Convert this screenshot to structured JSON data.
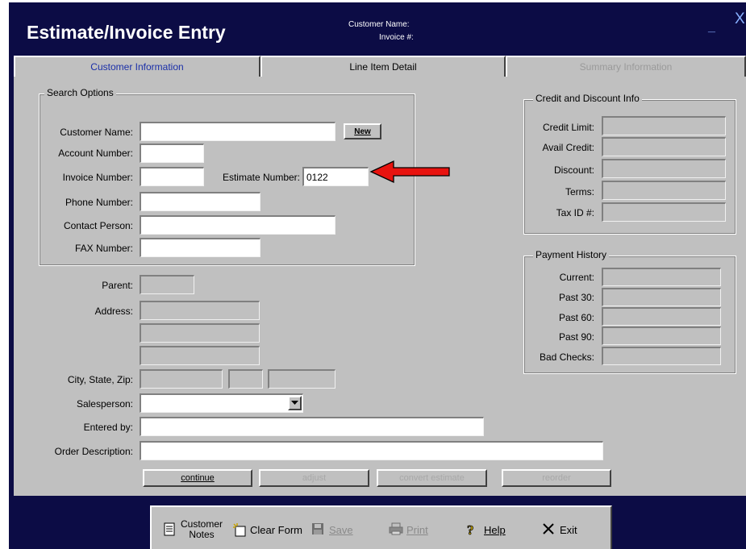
{
  "window": {
    "title": "Estimate/Invoice Entry",
    "customer_name_label": "Customer Name:",
    "invoice_label": "Invoice #:",
    "minimize": "_",
    "close": "X"
  },
  "tabs": [
    {
      "label": "Customer Information",
      "state": "active"
    },
    {
      "label": "Line Item Detail",
      "state": "normal"
    },
    {
      "label": "Summary Information",
      "state": "disabled"
    }
  ],
  "search": {
    "legend": "Search Options",
    "customer_name_label": "Customer Name:",
    "customer_name_value": "",
    "new_button": "New",
    "account_number_label": "Account Number:",
    "account_number_value": "",
    "invoice_number_label": "Invoice Number:",
    "invoice_number_value": "",
    "estimate_number_label": "Estimate Number:",
    "estimate_number_value": "0122",
    "phone_label": "Phone Number:",
    "phone_value": "",
    "contact_label": "Contact Person:",
    "contact_value": "",
    "fax_label": "FAX Number:",
    "fax_value": ""
  },
  "customer": {
    "parent_label": "Parent:",
    "address_label": "Address:",
    "city_state_zip_label": "City, State, Zip:",
    "salesperson_label": "Salesperson:",
    "salesperson_value": "",
    "entered_by_label": "Entered by:",
    "entered_by_value": "",
    "order_description_label": "Order Description:",
    "order_description_value": ""
  },
  "credit": {
    "legend": "Credit and Discount Info",
    "credit_limit": "Credit Limit:",
    "avail_credit": "Avail Credit:",
    "discount": "Discount:",
    "terms": "Terms:",
    "tax_id": "Tax ID #:"
  },
  "payment": {
    "legend": "Payment History",
    "current": "Current:",
    "past30": "Past 30:",
    "past60": "Past 60:",
    "past90": "Past 90:",
    "bad_checks": "Bad Checks:"
  },
  "actions": {
    "continue": "continue",
    "adjust": "adjust",
    "convert_estimate": "convert estimate",
    "reorder": "reorder"
  },
  "toolbar": {
    "customer_notes_line1": "Customer",
    "customer_notes_line2": "Notes",
    "clear_form": "Clear Form",
    "save": "Save",
    "print": "Print",
    "help": "Help",
    "exit": "Exit"
  },
  "colors": {
    "window_bg": "#0c0c45",
    "panel_bg": "#c0c0c0",
    "arrow": "#e8130f",
    "active_tab_text": "#1a2fa8"
  },
  "icons": [
    "notes-icon",
    "clear-form-icon",
    "save-icon",
    "print-icon",
    "help-icon",
    "exit-icon",
    "dropdown-arrow-icon",
    "red-arrow-icon"
  ]
}
